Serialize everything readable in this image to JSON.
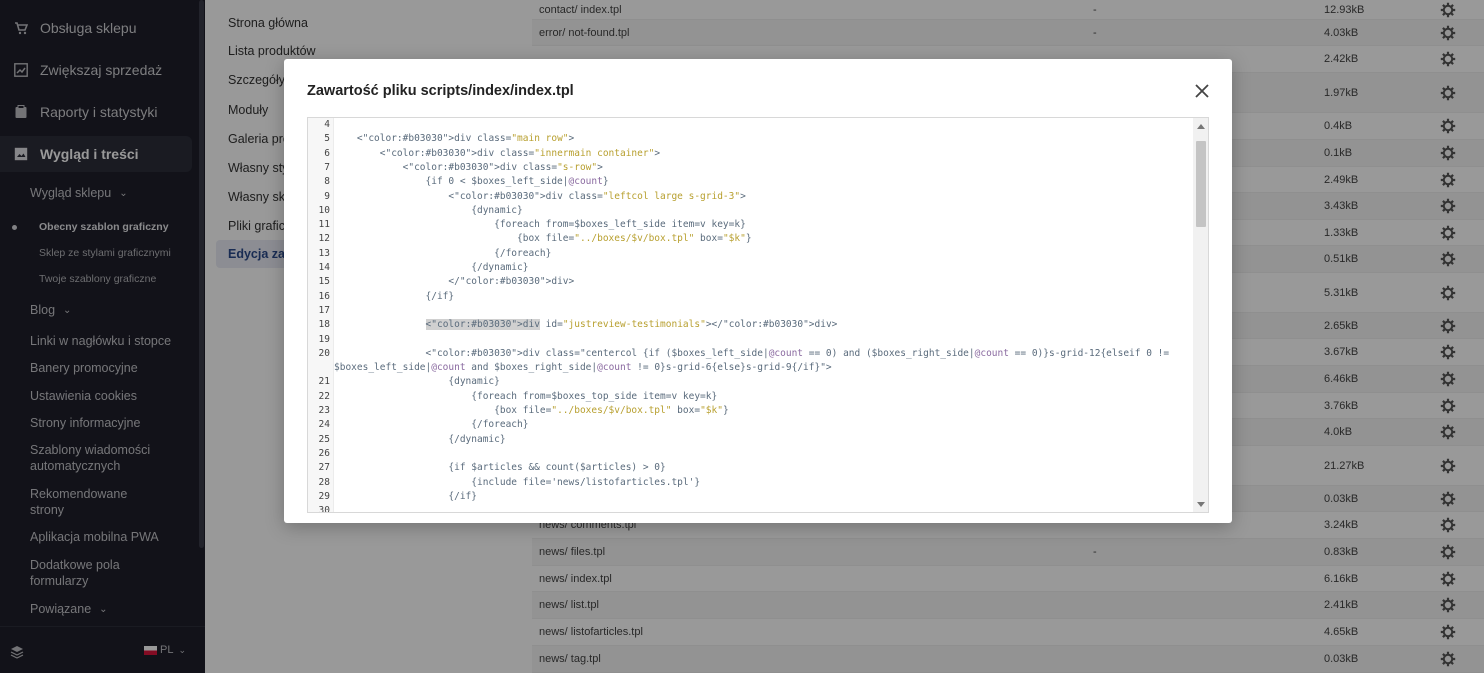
{
  "sidebar": {
    "main_items": [
      {
        "label": "Obsługa sklepu",
        "icon": "cart-icon"
      },
      {
        "label": "Zwiększaj sprzedaż",
        "icon": "chart-icon"
      },
      {
        "label": "Raporty i statystyki",
        "icon": "report-icon"
      },
      {
        "label": "Wygląd i treści",
        "icon": "layout-icon"
      }
    ],
    "sub_items": [
      "Wygląd sklepu",
      "Blog",
      "Linki w nagłówku i stopce",
      "Banery promocyjne",
      "Ustawienia cookies",
      "Strony informacyjne",
      "Szablony wiadomości",
      "automatycznych",
      "Rekomendowane",
      "strony",
      "Aplikacja mobilna PWA",
      "Dodatkowe pola",
      "formularzy",
      "Powiązane"
    ],
    "subsub_items": [
      "Obecny szablon graficzny",
      "Sklep ze stylami graficznymi",
      "Twoje szablony graficzne"
    ],
    "chevron": "⌄",
    "lang": "PL"
  },
  "midmenu": {
    "items": [
      "Strona główna",
      "Lista produktów",
      "Szczegóły",
      "Moduły",
      "Galeria pro",
      "Własny sty",
      "Własny sk",
      "Pliki grafic",
      "Edycja zaa"
    ]
  },
  "files": {
    "rows": [
      {
        "name": "contact/ index.tpl",
        "dash": "-",
        "size": "12.93kB"
      },
      {
        "name": "error/ not-found.tpl",
        "dash": "-",
        "size": "4.03kB"
      },
      {
        "name": "",
        "dash": "",
        "size": "2.42kB"
      },
      {
        "name": "",
        "dash": "",
        "size": "1.97kB"
      },
      {
        "name": "",
        "dash": "",
        "size": "0.4kB"
      },
      {
        "name": "",
        "dash": "",
        "size": "0.1kB"
      },
      {
        "name": "",
        "dash": "",
        "size": "2.49kB"
      },
      {
        "name": "",
        "dash": "",
        "size": "3.43kB"
      },
      {
        "name": "",
        "dash": "",
        "size": "1.33kB"
      },
      {
        "name": "",
        "dash": "",
        "size": "0.51kB"
      },
      {
        "name": "",
        "dash": "",
        "size": "5.31kB"
      },
      {
        "name": "",
        "dash": "",
        "size": "2.65kB"
      },
      {
        "name": "",
        "dash": "",
        "size": "3.67kB"
      },
      {
        "name": "",
        "dash": "",
        "size": "6.46kB"
      },
      {
        "name": "",
        "dash": "",
        "size": "3.76kB"
      },
      {
        "name": "",
        "dash": "",
        "size": "4.0kB"
      },
      {
        "name": "",
        "dash": "",
        "size": "21.27kB"
      },
      {
        "name": "",
        "dash": "",
        "size": "0.03kB"
      },
      {
        "name": "news/ comments.tpl",
        "dash": "",
        "size": "3.24kB"
      },
      {
        "name": "news/ files.tpl",
        "dash": "-",
        "size": "0.83kB"
      },
      {
        "name": "news/ index.tpl",
        "dash": "",
        "size": "6.16kB"
      },
      {
        "name": "news/ list.tpl",
        "dash": "",
        "size": "2.41kB"
      },
      {
        "name": "news/ listofarticles.tpl",
        "dash": "",
        "size": "4.65kB"
      },
      {
        "name": "news/ tag.tpl",
        "dash": "",
        "size": "0.03kB"
      }
    ]
  },
  "modal": {
    "title": "Zawartość pliku scripts/index/index.tpl",
    "code_lines": [
      {
        "n": "4",
        "text": ""
      },
      {
        "n": "5",
        "text": "    <div class=\"main row\">"
      },
      {
        "n": "6",
        "text": "        <div class=\"innermain container\">"
      },
      {
        "n": "7",
        "text": "            <div class=\"s-row\">"
      },
      {
        "n": "8",
        "text": "                {if 0 < $boxes_left_side|@count}"
      },
      {
        "n": "9",
        "text": "                    <div class=\"leftcol large s-grid-3\">"
      },
      {
        "n": "10",
        "text": "                        {dynamic}"
      },
      {
        "n": "11",
        "text": "                            {foreach from=$boxes_left_side item=v key=k}"
      },
      {
        "n": "12",
        "text": "                                {box file=\"../boxes/$v/box.tpl\" box=\"$k\"}"
      },
      {
        "n": "13",
        "text": "                            {/foreach}"
      },
      {
        "n": "14",
        "text": "                        {/dynamic}"
      },
      {
        "n": "15",
        "text": "                    </div>"
      },
      {
        "n": "16",
        "text": "                {/if}"
      },
      {
        "n": "17",
        "text": ""
      },
      {
        "n": "18",
        "text": "                <div id=\"justreview-testimonials\"></div>"
      },
      {
        "n": "19",
        "text": ""
      },
      {
        "n": "20",
        "text": "                <div class=\"centercol {if ($boxes_left_side|@count == 0) and ($boxes_right_side|@count == 0)}s-grid-12{elseif 0 !="
      },
      {
        "n": "",
        "text": "$boxes_left_side|@count and $boxes_right_side|@count != 0}s-grid-6{else}s-grid-9{/if}\">"
      },
      {
        "n": "21",
        "text": "                    {dynamic}"
      },
      {
        "n": "22",
        "text": "                        {foreach from=$boxes_top_side item=v key=k}"
      },
      {
        "n": "23",
        "text": "                            {box file=\"../boxes/$v/box.tpl\" box=\"$k\"}"
      },
      {
        "n": "24",
        "text": "                        {/foreach}"
      },
      {
        "n": "25",
        "text": "                    {/dynamic}"
      },
      {
        "n": "26",
        "text": ""
      },
      {
        "n": "27",
        "text": "                    {if $articles && count($articles) > 0}"
      },
      {
        "n": "28",
        "text": "                        {include file='news/listofarticles.tpl'}"
      },
      {
        "n": "29",
        "text": "                    {/if}"
      },
      {
        "n": "30",
        "text": ""
      }
    ]
  },
  "colors": {
    "sidebar_bg": "#1e1f2a",
    "active_item_bg": "#2c2d3a",
    "code_tag": "#b03030",
    "code_attr": "#b8a030",
    "code_var": "#8a6aa0",
    "overlay": "rgba(0,0,0,0.40)"
  }
}
